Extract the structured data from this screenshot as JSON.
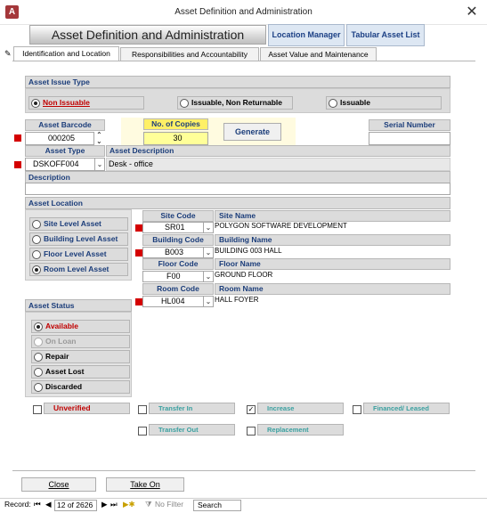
{
  "window": {
    "title": "Asset Definition and Administration",
    "app_icon": "A"
  },
  "header": {
    "title": "Asset Definition and Administration",
    "tabs": [
      "Location Manager",
      "Tabular Asset List"
    ]
  },
  "subtabs": [
    "Identification and Location",
    "Responsibilities and Accountability",
    "Asset Value and Maintenance"
  ],
  "issue": {
    "section": "Asset Issue Type",
    "options": [
      "Non Issuable",
      "Issuable, Non Returnable",
      "Issuable"
    ],
    "selected": "Non Issuable"
  },
  "barcode": {
    "label": "Asset Barcode",
    "value": "000205"
  },
  "copies": {
    "label": "No. of Copies",
    "value": "30",
    "generate": "Generate"
  },
  "serial": {
    "label": "Serial Number",
    "value": ""
  },
  "asset_type": {
    "label": "Asset Type",
    "value": "DSKOFF004"
  },
  "asset_desc": {
    "label": "Asset Description",
    "value": "Desk - office"
  },
  "description": {
    "label": "Description",
    "value": ""
  },
  "location": {
    "section": "Asset Location",
    "levels": [
      "Site Level Asset",
      "Building Level Asset",
      "Floor Level Asset",
      "Room Level Asset"
    ],
    "selected": "Room Level Asset",
    "rows": [
      {
        "code_label": "Site Code",
        "name_label": "Site Name",
        "code": "SR01",
        "name": "POLYGON SOFTWARE DEVELOPMENT"
      },
      {
        "code_label": "Building Code",
        "name_label": "Building Name",
        "code": "B003",
        "name": "BUILDING 003 HALL"
      },
      {
        "code_label": "Floor Code",
        "name_label": "Floor Name",
        "code": "F00",
        "name": "GROUND FLOOR"
      },
      {
        "code_label": "Room Code",
        "name_label": "Room Name",
        "code": "HL004",
        "name": "HALL FOYER"
      }
    ]
  },
  "status": {
    "section": "Asset Status",
    "options": [
      "Available",
      "On Loan",
      "Repair",
      "Asset Lost",
      "Discarded"
    ],
    "selected": "Available"
  },
  "flags": {
    "unverified": "Unverified",
    "transfer_in": "Transfer In",
    "increase": "Increase",
    "financed": "Financed/ Leased",
    "transfer_out": "Transfer Out",
    "replacement": "Replacement"
  },
  "buttons": {
    "close": "Close",
    "take_on": "Take On"
  },
  "statusbar": {
    "record_label": "Record:",
    "record_pos": "12 of 2626",
    "filter": "No Filter",
    "search": "Search"
  },
  "colors": {
    "accent_red": "#d40000",
    "label_blue": "#1b3d7a",
    "copies_yellow": "#ffff99"
  }
}
